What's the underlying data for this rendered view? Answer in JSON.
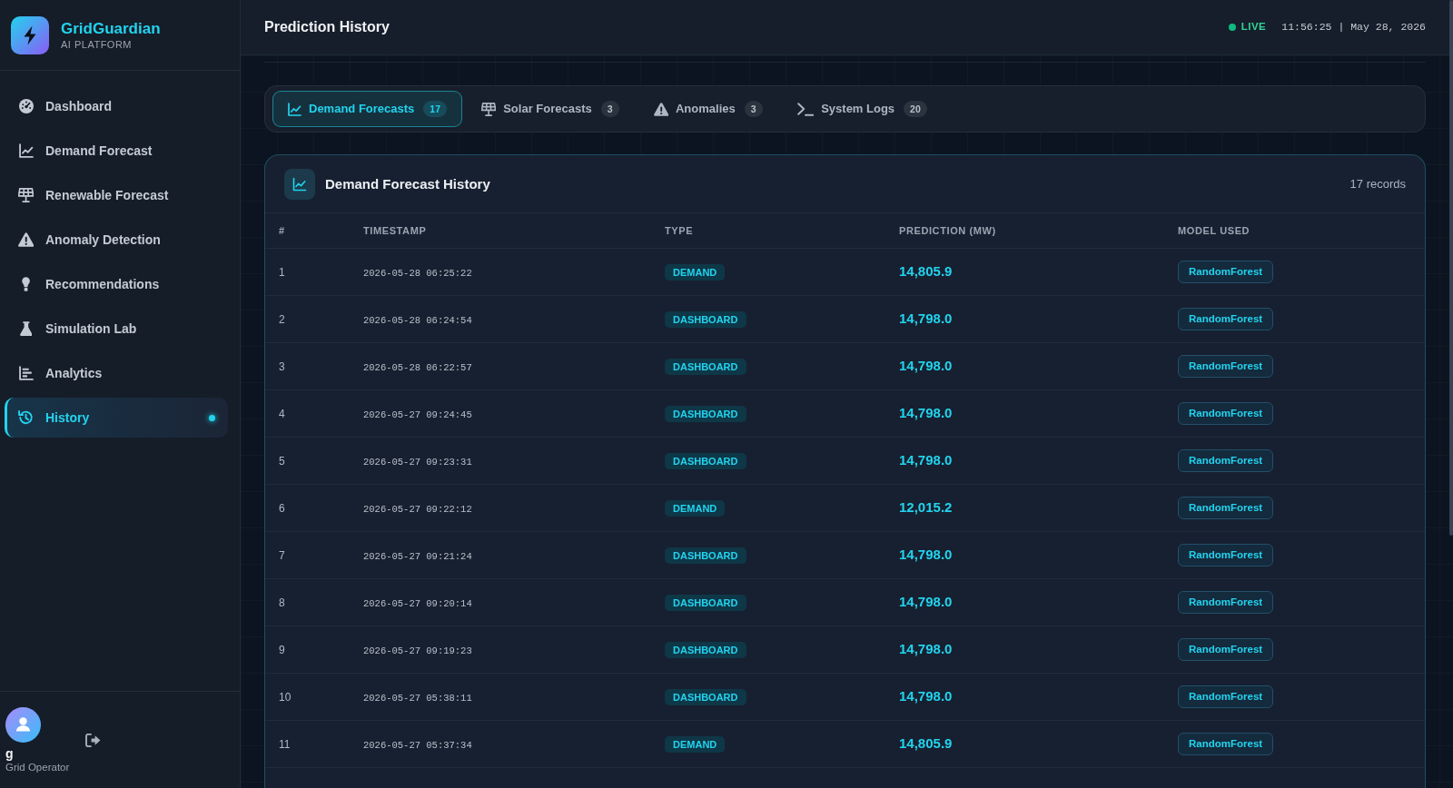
{
  "brand": {
    "name": "GridGuardian",
    "tagline": "AI PLATFORM"
  },
  "sidebar": {
    "items": [
      {
        "label": "Dashboard",
        "selected": false
      },
      {
        "label": "Demand Forecast",
        "selected": false
      },
      {
        "label": "Renewable Forecast",
        "selected": false
      },
      {
        "label": "Anomaly Detection",
        "selected": false
      },
      {
        "label": "Recommendations",
        "selected": false
      },
      {
        "label": "Simulation Lab",
        "selected": false
      },
      {
        "label": "Analytics",
        "selected": false
      },
      {
        "label": "History",
        "selected": true
      }
    ]
  },
  "user": {
    "name": "g",
    "role": "Grid Operator"
  },
  "header": {
    "title": "Prediction History",
    "status": "LIVE",
    "clock": "11:56:25 | May 28, 2026"
  },
  "tabs": [
    {
      "label": "Demand Forecasts",
      "count": "17",
      "selected": true
    },
    {
      "label": "Solar Forecasts",
      "count": "3",
      "selected": false
    },
    {
      "label": "Anomalies",
      "count": "3",
      "selected": false
    },
    {
      "label": "System Logs",
      "count": "20",
      "selected": false
    }
  ],
  "panel": {
    "title": "Demand Forecast History",
    "record_count": "17 records"
  },
  "table": {
    "columns": [
      "#",
      "TIMESTAMP",
      "TYPE",
      "PREDICTION (MW)",
      "MODEL USED"
    ],
    "rows": [
      {
        "index": "1",
        "timestamp": "2026-05-28 06:25:22",
        "type": "DEMAND",
        "prediction": "14,805.9",
        "model": "RandomForest"
      },
      {
        "index": "2",
        "timestamp": "2026-05-28 06:24:54",
        "type": "DASHBOARD",
        "prediction": "14,798.0",
        "model": "RandomForest"
      },
      {
        "index": "3",
        "timestamp": "2026-05-28 06:22:57",
        "type": "DASHBOARD",
        "prediction": "14,798.0",
        "model": "RandomForest"
      },
      {
        "index": "4",
        "timestamp": "2026-05-27 09:24:45",
        "type": "DASHBOARD",
        "prediction": "14,798.0",
        "model": "RandomForest"
      },
      {
        "index": "5",
        "timestamp": "2026-05-27 09:23:31",
        "type": "DASHBOARD",
        "prediction": "14,798.0",
        "model": "RandomForest"
      },
      {
        "index": "6",
        "timestamp": "2026-05-27 09:22:12",
        "type": "DEMAND",
        "prediction": "12,015.2",
        "model": "RandomForest"
      },
      {
        "index": "7",
        "timestamp": "2026-05-27 09:21:24",
        "type": "DASHBOARD",
        "prediction": "14,798.0",
        "model": "RandomForest"
      },
      {
        "index": "8",
        "timestamp": "2026-05-27 09:20:14",
        "type": "DASHBOARD",
        "prediction": "14,798.0",
        "model": "RandomForest"
      },
      {
        "index": "9",
        "timestamp": "2026-05-27 09:19:23",
        "type": "DASHBOARD",
        "prediction": "14,798.0",
        "model": "RandomForest"
      },
      {
        "index": "10",
        "timestamp": "2026-05-27 05:38:11",
        "type": "DASHBOARD",
        "prediction": "14,798.0",
        "model": "RandomForest"
      },
      {
        "index": "11",
        "timestamp": "2026-05-27 05:37:34",
        "type": "DEMAND",
        "prediction": "14,805.9",
        "model": "RandomForest"
      }
    ]
  }
}
